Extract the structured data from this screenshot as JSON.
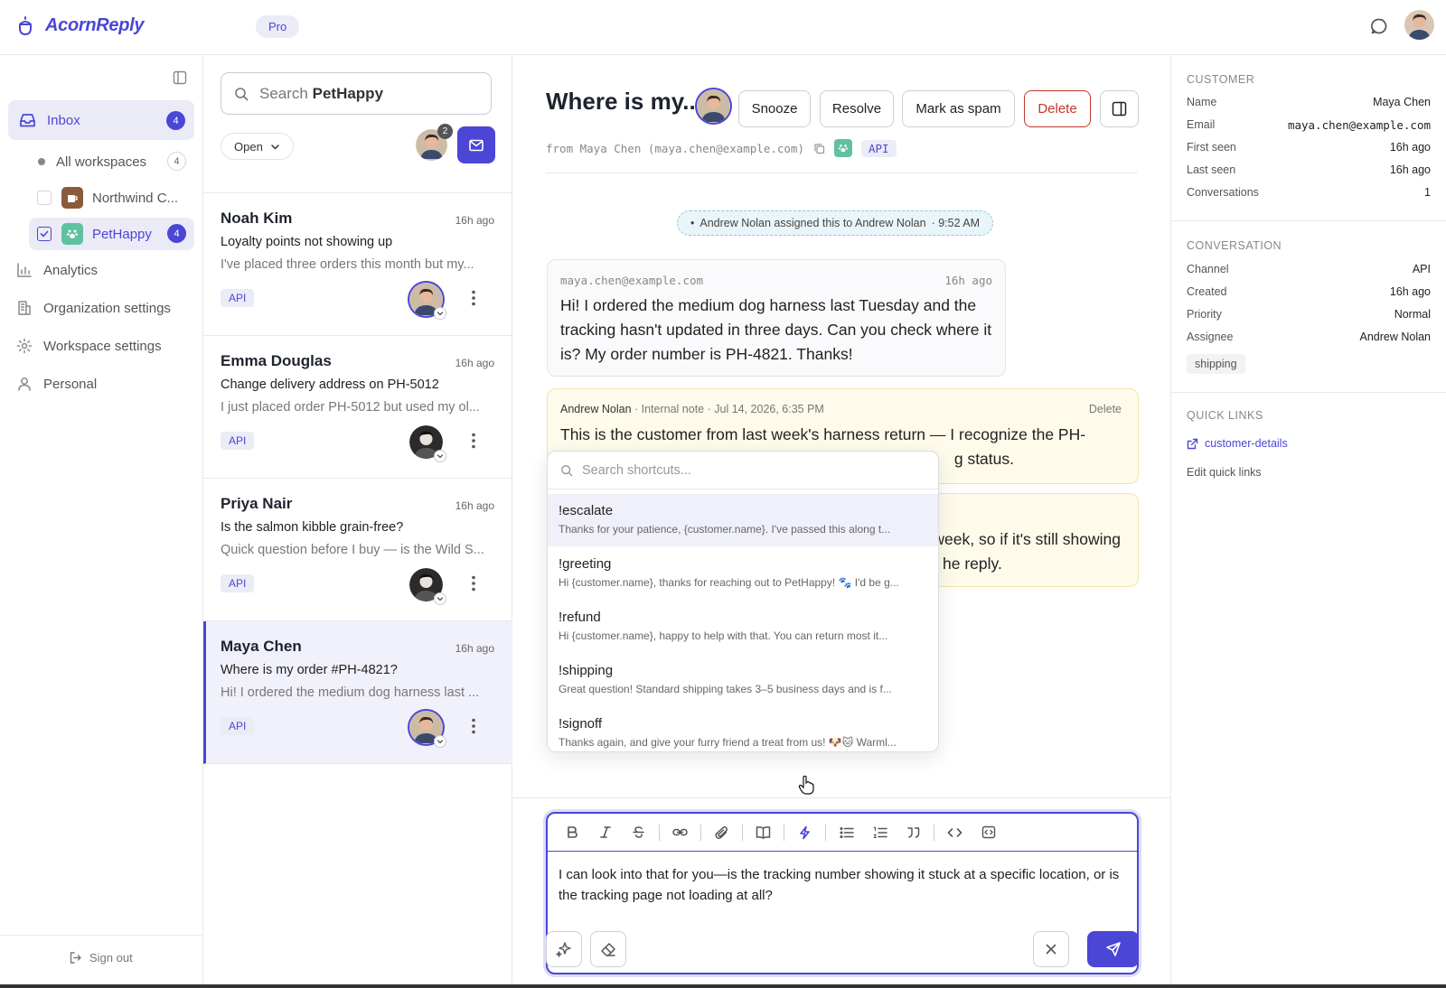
{
  "app": {
    "name": "AcornReply",
    "plan_badge": "Pro",
    "accent_color": "#4b46d6"
  },
  "sidebar": {
    "inbox_label": "Inbox",
    "inbox_count": "4",
    "workspaces": [
      {
        "label": "All workspaces",
        "count": "4"
      },
      {
        "label": "Northwind C..."
      },
      {
        "label": "PetHappy",
        "count": "4"
      }
    ],
    "nav": [
      {
        "label": "Analytics",
        "icon": "bar-chart-icon"
      },
      {
        "label": "Organization settings",
        "icon": "building-icon"
      },
      {
        "label": "Workspace settings",
        "icon": "gear-icon"
      },
      {
        "label": "Personal",
        "icon": "person-icon"
      }
    ],
    "signout_label": "Sign out"
  },
  "conversation_list": {
    "search_prefix": "Search",
    "search_workspace": "PetHappy",
    "status_filter": "Open",
    "assignee_count": "2",
    "items": [
      {
        "name": "Noah Kim",
        "time": "16h ago",
        "subject": "Loyalty points not showing up",
        "preview": "I've placed three orders this month but my...",
        "channel": "API"
      },
      {
        "name": "Emma Douglas",
        "time": "16h ago",
        "subject": "Change delivery address on PH-5012",
        "preview": "I just placed order PH-5012 but used my ol...",
        "channel": "API"
      },
      {
        "name": "Priya Nair",
        "time": "16h ago",
        "subject": "Is the salmon kibble grain-free?",
        "preview": "Quick question before I buy — is the Wild S...",
        "channel": "API"
      },
      {
        "name": "Maya Chen",
        "time": "16h ago",
        "subject": "Where is my order #PH-4821?",
        "preview": "Hi! I ordered the medium dog harness last ...",
        "channel": "API"
      }
    ]
  },
  "conversation": {
    "title": "Where is my...",
    "actions": {
      "snooze": "Snooze",
      "resolve": "Resolve",
      "spam": "Mark as spam",
      "delete": "Delete"
    },
    "from_line": "from Maya Chen (maya.chen@example.com)",
    "channel": "API",
    "system_event": "Andrew Nolan assigned this to Andrew Nolan",
    "system_event_time": "9:52 AM",
    "customer_message": {
      "sender": "maya.chen@example.com",
      "time": "16h ago",
      "body": "Hi! I ordered the medium dog harness last Tuesday and the tracking hasn't updated in three days. Can you check where it is? My order number is PH-4821. Thanks!"
    },
    "note": {
      "author": "Andrew Nolan",
      "meta": "· Internal note · Jul 14, 2026, 6:35 PM",
      "delete_label": "Delete",
      "line1": "This is the customer from last week's harness return — I recognize the PH-",
      "line2_visible": "g status."
    },
    "note2": {
      "line1_visible": "week, so if it's still showing",
      "line2_visible": "he reply."
    }
  },
  "shortcuts": {
    "placeholder": "Search shortcuts...",
    "items": [
      {
        "command": "!escalate",
        "snippet": "Thanks for your patience, {customer.name}. I've passed this along t..."
      },
      {
        "command": "!greeting",
        "snippet": "Hi {customer.name}, thanks for reaching out to PetHappy! 🐾 I'd be g..."
      },
      {
        "command": "!refund",
        "snippet": "Hi {customer.name}, happy to help with that. You can return most it..."
      },
      {
        "command": "!shipping",
        "snippet": "Great question! Standard shipping takes 3–5 business days and is f..."
      },
      {
        "command": "!signoff",
        "snippet": "Thanks again, and give your furry friend a treat from us! 🐶🐱 Warml..."
      }
    ]
  },
  "composer": {
    "text": "I can look into that for you—is the tracking number showing it stuck at a specific location, or is the tracking page not loading at all?"
  },
  "customer_panel": {
    "heading": "CUSTOMER",
    "fields": [
      {
        "label": "Name",
        "value": "Maya Chen"
      },
      {
        "label": "Email",
        "value": "maya.chen@example.com"
      },
      {
        "label": "First seen",
        "value": "16h ago"
      },
      {
        "label": "Last seen",
        "value": "16h ago"
      },
      {
        "label": "Conversations",
        "value": "1"
      }
    ],
    "conversation_heading": "CONVERSATION",
    "conversation_fields": [
      {
        "label": "Channel",
        "value": "API"
      },
      {
        "label": "Created",
        "value": "16h ago"
      },
      {
        "label": "Priority",
        "value": "Normal"
      },
      {
        "label": "Assignee",
        "value": "Andrew Nolan"
      }
    ],
    "tag": "shipping",
    "quick_links_heading": "QUICK LINKS",
    "quick_link": "customer-details",
    "edit_quick_links": "Edit quick links"
  }
}
